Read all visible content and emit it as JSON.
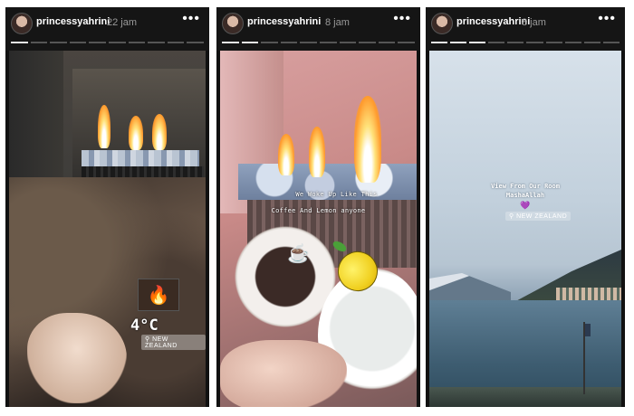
{
  "stories": [
    {
      "username": "princessyahrini",
      "time": "22 jam",
      "more_label": "•••",
      "progress_total": 10,
      "progress_done": 1,
      "stickers": {
        "temperature": "4°C",
        "location": "NEW ZEALAND",
        "fireplace_icon": "fireplace-sticker"
      }
    },
    {
      "username": "princessyahrini",
      "time": "8 jam",
      "more_label": "•••",
      "progress_total": 10,
      "progress_done": 2,
      "caption_line1": "We Woke Up Like This",
      "caption_line2": "Coffee And Lemon anyone",
      "stickers": {
        "coffee_icon": "☕",
        "lemon_icon": "lemon-sticker"
      }
    },
    {
      "username": "princessyahrini",
      "time": "8 jam",
      "more_label": "•••",
      "progress_total": 10,
      "progress_done": 3,
      "caption_line1": "View From Our Room",
      "caption_line2": "MashaAllah",
      "heart": "💜",
      "stickers": {
        "location": "NEW ZEALAND"
      }
    }
  ],
  "colors": {
    "header_bg": "#151515",
    "progress_done": "#e8e8e8",
    "progress_todo": "#555555"
  }
}
